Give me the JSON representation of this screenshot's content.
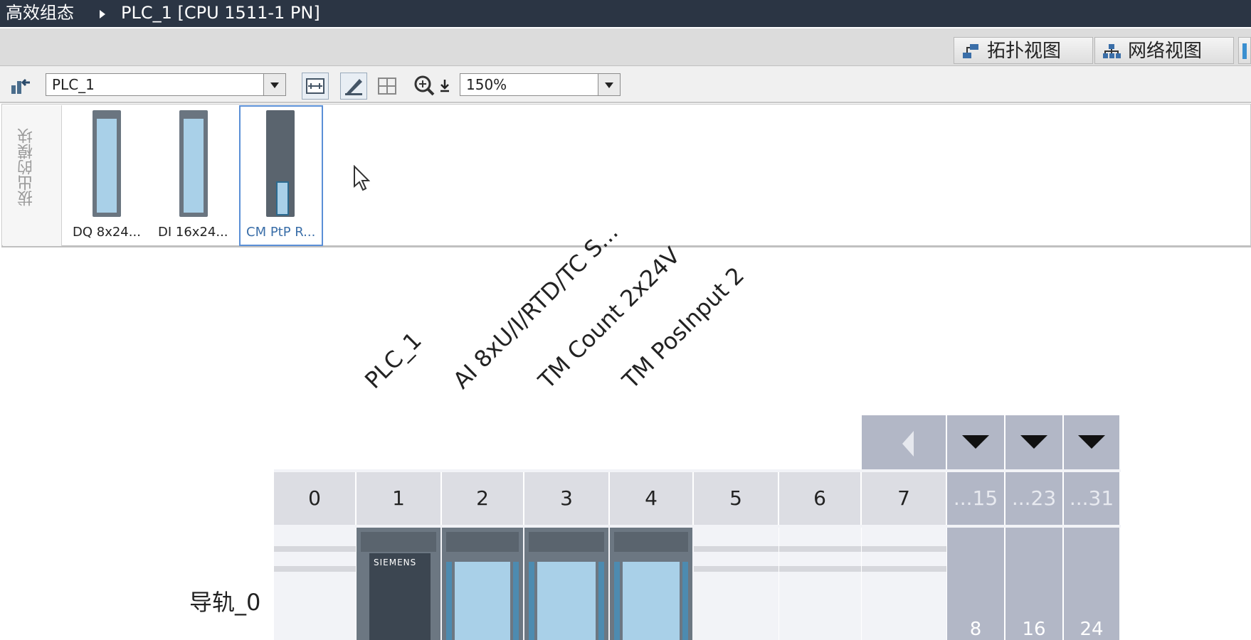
{
  "title_bar": {
    "project": "高效组态",
    "device": "PLC_1 [CPU 1511-1 PN]"
  },
  "view_tabs": [
    {
      "label": "拓扑视图",
      "icon": "topology-icon"
    },
    {
      "label": "网络视图",
      "icon": "network-icon"
    }
  ],
  "toolbar": {
    "device_select": "PLC_1",
    "zoom": "150%"
  },
  "unplugged_modules": {
    "title": "拔出的模块",
    "items": [
      {
        "label": "DQ 8x24..."
      },
      {
        "label": "DI 16x24..."
      },
      {
        "label": "CM PtP R..."
      }
    ]
  },
  "device_labels": [
    "PLC_1",
    "AI 8xU/I/RTD/TC S...",
    "TM Count 2x24V",
    "TM PosInput 2"
  ],
  "rack": {
    "name": "导轨_0",
    "slots": [
      "0",
      "1",
      "2",
      "3",
      "4",
      "5",
      "6",
      "7"
    ],
    "ext_slots": [
      "...15",
      "...23",
      "...31"
    ],
    "ext_start": [
      "8",
      "16",
      "24"
    ],
    "cpu_brand": "SIEMENS"
  }
}
